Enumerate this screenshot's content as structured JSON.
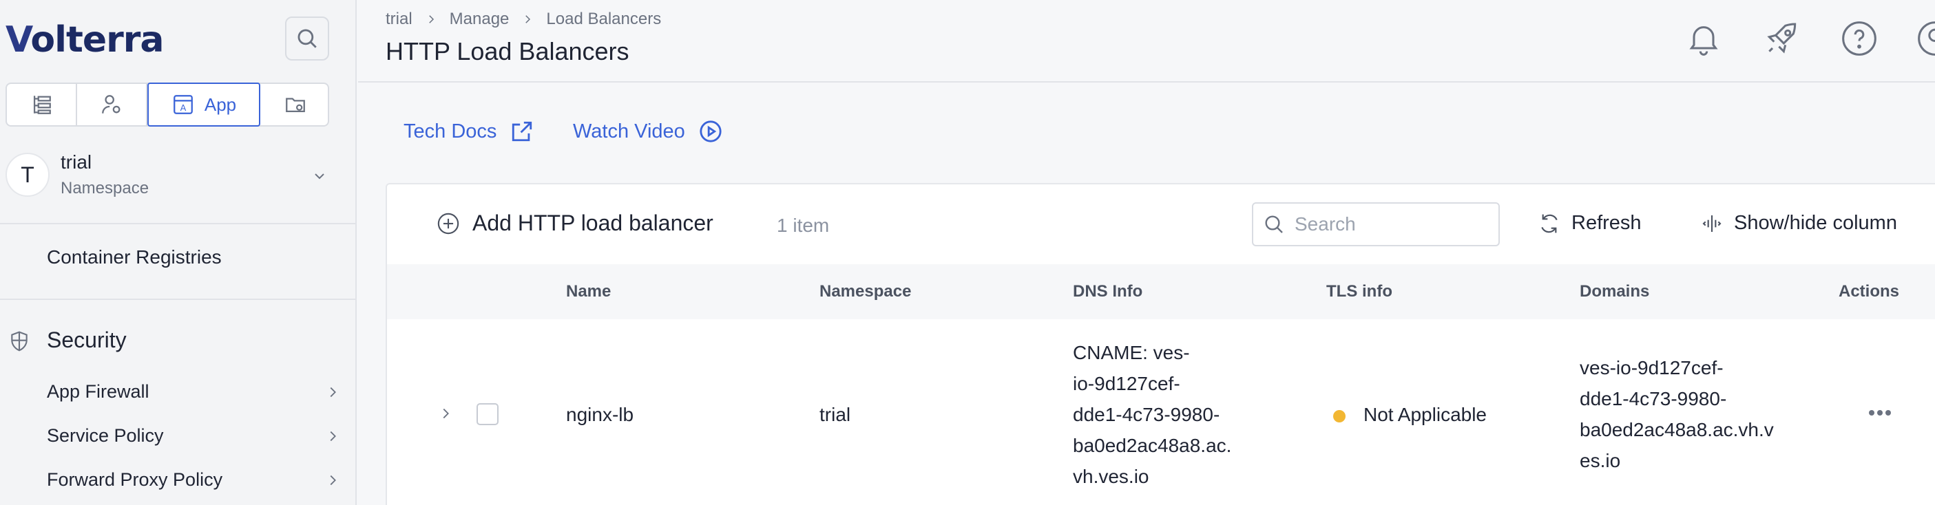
{
  "brand": {
    "logo_text_v": "V",
    "logo_text_rest": "olterra"
  },
  "sidebar": {
    "app_tab_label": "App",
    "namespace": {
      "avatar_letter": "T",
      "name": "trial",
      "label": "Namespace"
    },
    "container_registries": "Container Registries",
    "security_title": "Security",
    "security_items": [
      {
        "label": "App Firewall"
      },
      {
        "label": "Service Policy"
      },
      {
        "label": "Forward Proxy Policy"
      }
    ]
  },
  "header": {
    "breadcrumb": [
      "trial",
      "Manage",
      "Load Balancers"
    ],
    "title": "HTTP Load Balancers"
  },
  "links": {
    "tech_docs": "Tech Docs",
    "watch_video": "Watch Video"
  },
  "toolbar": {
    "add_label": "Add HTTP load balancer",
    "item_count": "1 item",
    "search_placeholder": "Search",
    "refresh_label": "Refresh",
    "show_hide_label": "Show/hide column"
  },
  "table": {
    "columns": [
      "Name",
      "Namespace",
      "DNS Info",
      "TLS info",
      "Domains",
      "Actions"
    ],
    "rows": [
      {
        "name": "nginx-lb",
        "namespace": "trial",
        "dns_lines": [
          "CNAME: ves-",
          "io-9d127cef-",
          "dde1-4c73-9980-",
          "ba0ed2ac48a8.ac.",
          "vh.ves.io"
        ],
        "tls": "Not Applicable",
        "tls_status_color": "#f2b733",
        "domain_lines": [
          "ves-io-9d127cef-",
          "dde1-4c73-9980-",
          "ba0ed2ac48a8.ac.vh.v",
          "es.io"
        ]
      }
    ]
  },
  "colors": {
    "accent": "#3a63d8",
    "brand": "#1c2a63"
  }
}
